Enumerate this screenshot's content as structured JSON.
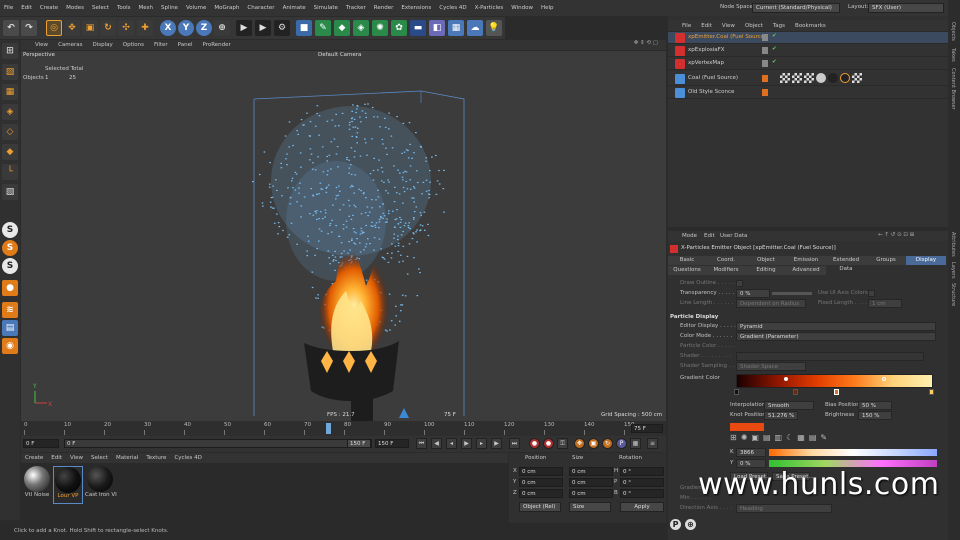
{
  "menubar": {
    "items": [
      "File",
      "Edit",
      "Create",
      "Modes",
      "Select",
      "Tools",
      "Mesh",
      "Spline",
      "Volume",
      "MoGraph",
      "Character",
      "Animate",
      "Simulate",
      "Tracker",
      "Render",
      "Extensions",
      "Cycles 4D",
      "X-Particles",
      "Window",
      "Help"
    ],
    "node_space_label": "Node Space:",
    "node_space_value": "Current (Standard/Physical)",
    "layout_label": "Layout:",
    "layout_value": "SFX (User)"
  },
  "toolbar": {
    "axis_x": "X",
    "axis_y": "Y",
    "axis_z": "Z"
  },
  "viewport": {
    "menu": [
      "View",
      "Cameras",
      "Display",
      "Options",
      "Filter",
      "Panel",
      "ProRender"
    ],
    "view_name": "Perspective",
    "camera": "Default Camera",
    "selected_total_label": "Selected Total",
    "objects_label": "Objects",
    "objects_selected": "1",
    "objects_total": "25",
    "fps": "FPS : 21.7",
    "frame": "75 F",
    "grid_spacing": "Grid Spacing : 500 cm"
  },
  "timeline": {
    "ticks": [
      "0",
      "10",
      "20",
      "30",
      "40",
      "50",
      "60",
      "70",
      "80",
      "90",
      "100",
      "110",
      "120",
      "130",
      "140",
      "150"
    ],
    "current_frame_field": "75 F",
    "start": "0 F",
    "start2": "0 F",
    "end": "150 F",
    "end2": "150 F"
  },
  "materials": {
    "menu": [
      "Create",
      "Edit",
      "View",
      "Select",
      "Material",
      "Texture",
      "Cycles 4D"
    ],
    "items": [
      {
        "name": "Vtl Noise"
      },
      {
        "name": "Lour VP"
      },
      {
        "name": "Cast Iron VI"
      }
    ]
  },
  "coords": {
    "headers": [
      "Position",
      "Size",
      "Rotation"
    ],
    "rows": [
      {
        "axis": "X",
        "pos": "0 cm",
        "size": "0 cm",
        "rot_axis": "H",
        "rot": "0 °"
      },
      {
        "axis": "Y",
        "pos": "0 cm",
        "size": "0 cm",
        "rot_axis": "P",
        "rot": "0 °"
      },
      {
        "axis": "Z",
        "pos": "0 cm",
        "size": "0 cm",
        "rot_axis": "B",
        "rot": "0 °"
      }
    ],
    "mode_left": "Object (Rel)",
    "mode_mid": "Size",
    "apply": "Apply"
  },
  "status": "Click to add a Knot. Hold Shift to rectangle-select Knots.",
  "object_manager": {
    "menu": [
      "File",
      "Edit",
      "View",
      "Object",
      "Tags",
      "Bookmarks"
    ],
    "objects": [
      {
        "name": "xpEmitter.Coal (Fuel Source)",
        "selected": true,
        "color": "#d32f2f"
      },
      {
        "name": "xpExplosiaFX",
        "selected": false,
        "color": "#d32f2f"
      },
      {
        "name": "xpVertexMap",
        "selected": false,
        "color": "#d32f2f"
      },
      {
        "name": "Coal (Fuel Source)",
        "selected": false,
        "color": "#4a8fd8"
      },
      {
        "name": "Old Style Sconce",
        "selected": false,
        "color": "#4a8fd8"
      }
    ]
  },
  "attributes": {
    "menu": [
      "Mode",
      "Edit",
      "User Data"
    ],
    "title": "X-Particles Emitter Object [xpEmitter.Coal (Fuel Source)]",
    "tabs_row1": [
      "Basic",
      "Coord.",
      "Object",
      "Emission",
      "Extended Data",
      "Groups",
      "Display"
    ],
    "tabs_row2": [
      "Questions",
      "Modifiers",
      "Editing",
      "Advanced"
    ],
    "active_tab": "Display",
    "draw_outline": "Draw Outline . . . . . . .",
    "transparency_label": "Transparency . . . . .",
    "transparency_value": "0 %",
    "use_ui_axis_colors": "Use UI Axis Colors",
    "line_length_label": "Line Length . . . . . .",
    "line_length_value": "Dependent on Radius",
    "fixed_length_label": "Fixed Length . . . . .",
    "fixed_length_value": "1 cm",
    "section_particle_display": "Particle Display",
    "editor_display_label": "Editor Display . . . . .",
    "editor_display_value": "Pyramid",
    "color_mode_label": "Color Mode . . . . . .",
    "color_mode_value": "Gradient (Parameter)",
    "particle_color_label": "Particle Color . . . . .",
    "shader_label": "Shader . . . . . . . . .",
    "shader_sampling_label": "Shader Sampling . . .",
    "shader_sampling_value": "Shader Space",
    "gradient_color_label": "Gradient Color",
    "interpolation_label": "Interpolation",
    "interpolation_value": "Smooth",
    "bias_position_label": "Bias Position",
    "bias_position_value": "50 %",
    "knot_position_label": "Knot Position",
    "knot_position_value": "51.276 %",
    "brightness_label": "Brightness",
    "brightness_value": "150 %",
    "k_label": "K",
    "k_value": "3866",
    "y_label": "Y",
    "y_value": "0 %",
    "load_preset": "Load Preset...",
    "save_preset": "Save Preset...",
    "gradient_alpha_label": "Gradient . . .",
    "min_label": "Min . . . . . .",
    "direction_axis_label": "Direction Axis . . . .",
    "direction_axis_value": "Heading",
    "gradient_stops": [
      "#1a0000",
      "#8a1500",
      "#e03a00",
      "#ff7a1a",
      "#ffd27a",
      "#fff0b0"
    ]
  },
  "side_tabs": [
    "Objects",
    "Takes",
    "Content Browser",
    "Attributes",
    "Layers",
    "Structure"
  ],
  "watermark": "www.hunls.com"
}
